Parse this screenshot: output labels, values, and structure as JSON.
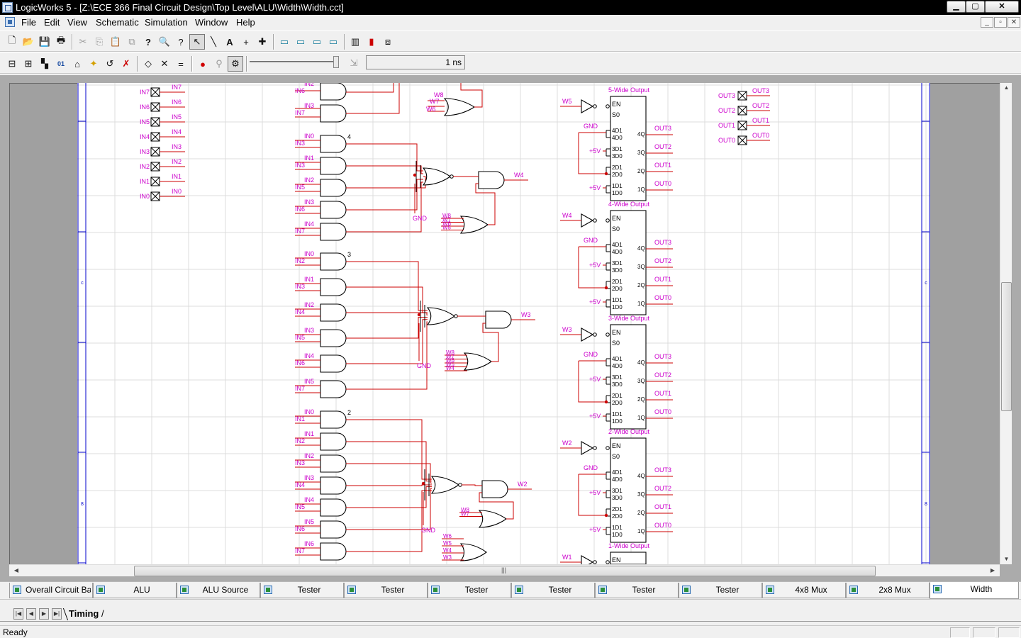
{
  "window": {
    "title": "LogicWorks 5 - [Z:\\ECE 366 Final Circuit Design\\Top Level\\ALU\\Width\\Width.cct]",
    "min_glyph": "▁",
    "max_glyph": "▢",
    "close_glyph": "✕"
  },
  "menu": {
    "items": [
      "File",
      "Edit",
      "View",
      "Schematic",
      "Simulation",
      "Window",
      "Help"
    ],
    "mdi_buttons": [
      "_",
      "▫",
      "✕"
    ]
  },
  "toolbar1": {
    "buttons": [
      {
        "icon": "new-file-icon",
        "glyph": "🗋"
      },
      {
        "icon": "open-folder-icon",
        "glyph": "📂"
      },
      {
        "icon": "save-icon",
        "glyph": "💾"
      },
      {
        "icon": "print-icon",
        "glyph": "🖶"
      },
      {
        "icon": "cut-icon",
        "glyph": "✂"
      },
      {
        "icon": "copy-icon",
        "glyph": "⎘"
      },
      {
        "icon": "paste-icon",
        "glyph": "📋"
      },
      {
        "icon": "duplicate-icon",
        "glyph": "⧉"
      },
      {
        "icon": "help-icon",
        "glyph": "?"
      },
      {
        "icon": "zoom-icon",
        "glyph": "🔍"
      },
      {
        "icon": "zoom-query-icon",
        "glyph": "?"
      },
      {
        "icon": "pointer-icon",
        "glyph": "↖"
      },
      {
        "icon": "wire-draw-icon",
        "glyph": "╲"
      },
      {
        "icon": "text-tool-icon",
        "glyph": "A"
      },
      {
        "icon": "crosshair-icon",
        "glyph": "+"
      },
      {
        "icon": "add-point-icon",
        "glyph": "✚"
      },
      {
        "icon": "component-view-icon",
        "glyph": "▭"
      },
      {
        "icon": "component-view2-icon",
        "glyph": "▭"
      },
      {
        "icon": "component-view3-icon",
        "glyph": "▭"
      },
      {
        "icon": "component-view4-icon",
        "glyph": "▭"
      },
      {
        "icon": "chip-icon",
        "glyph": "▥"
      },
      {
        "icon": "bar-chart-icon",
        "glyph": "▮"
      },
      {
        "icon": "network-icon",
        "glyph": "⧈"
      }
    ]
  },
  "toolbar2": {
    "buttons": [
      {
        "icon": "align-icon",
        "glyph": "⊟"
      },
      {
        "icon": "bus-icon",
        "glyph": "⊞"
      },
      {
        "icon": "probe-icon",
        "glyph": "▚"
      },
      {
        "icon": "binary-display-icon",
        "glyph": "01"
      },
      {
        "icon": "clock-icon",
        "glyph": "⌂"
      },
      {
        "icon": "spark-icon",
        "glyph": "✦"
      },
      {
        "icon": "undo-icon",
        "glyph": "↺"
      },
      {
        "icon": "delete-signal-icon",
        "glyph": "✗"
      },
      {
        "icon": "diamond-icon",
        "glyph": "◇"
      },
      {
        "icon": "x-icon",
        "glyph": "✕"
      },
      {
        "icon": "equals-icon",
        "glyph": "="
      },
      {
        "icon": "stop-icon",
        "glyph": "●"
      },
      {
        "icon": "walk-icon",
        "glyph": "⚲"
      },
      {
        "icon": "run-icon",
        "glyph": "⚙"
      }
    ],
    "time_value": "1 ns",
    "step_icon": "step-icon"
  },
  "schematic": {
    "input_labels": [
      "IN7",
      "IN6",
      "IN5",
      "IN4",
      "IN3",
      "IN2",
      "IN1",
      "IN0"
    ],
    "output_labels": [
      "OUT3",
      "OUT2",
      "OUT1",
      "OUT0"
    ],
    "group_numbers": [
      "4",
      "3",
      "2"
    ],
    "nets": {
      "w4": "W4",
      "w3": "W3",
      "w2": "W2",
      "w1": "W1",
      "w5": "W5",
      "w6": "W6",
      "w7": "W7",
      "w8": "W8",
      "gnd": "GND",
      "vcc": "+5V"
    },
    "mux_titles": [
      "5-Wide Output",
      "4-Wide Output",
      "3-Wide Output",
      "2-Wide Output",
      "1-Wide Output"
    ],
    "mux_pins": {
      "en": "EN",
      "s0": "S0",
      "4d1": "4D1",
      "4d0": "4D0",
      "3d1": "3D1",
      "3d0": "3D0",
      "2d1": "2D1",
      "2d0": "2D0",
      "1d1": "1D1",
      "1d0": "1D0",
      "4q": "4Q",
      "3q": "3Q",
      "2q": "2Q",
      "1q": "1Q"
    },
    "border_letters": [
      "c",
      "8"
    ],
    "colors": {
      "wire": "#cc0000",
      "label": "#cc00cc",
      "gate": "#000000",
      "border": "#0000cc",
      "grid": "#dcdcdc"
    }
  },
  "tabs": [
    "Overall Circuit Ba...",
    "ALU",
    "ALU Source",
    "Tester",
    "Tester",
    "Tester",
    "Tester",
    "Tester",
    "Tester",
    "4x8 Mux",
    "2x8 Mux",
    "Width"
  ],
  "timing": {
    "tab_label": "Timing",
    "tab_sep": "/",
    "nav": [
      "|◀",
      "◀",
      "▶",
      "▶|"
    ]
  },
  "status": {
    "text": "Ready"
  }
}
